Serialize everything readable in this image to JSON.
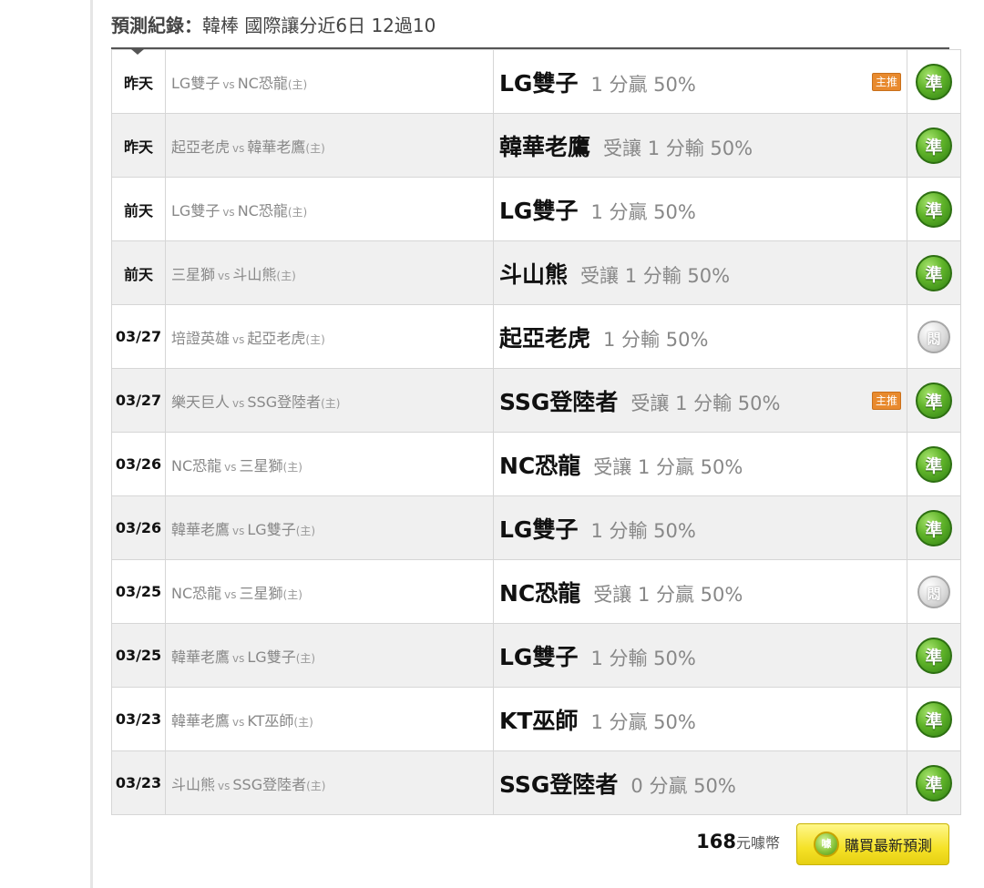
{
  "header": {
    "label": "預測紀錄",
    "colon": "：",
    "value": "韓棒 國際讓分近6日 12過10"
  },
  "rows": [
    {
      "date": "昨天",
      "away": "LG雙子",
      "vs": "vs",
      "home": "NC恐龍",
      "home_tag": "(主)",
      "pick_team": "LG雙子",
      "pick_line": "1 分贏 50%",
      "star": "主推",
      "result": "準",
      "result_type": "win"
    },
    {
      "date": "昨天",
      "away": "起亞老虎",
      "vs": "vs",
      "home": "韓華老鷹",
      "home_tag": "(主)",
      "pick_team": "韓華老鷹",
      "pick_line": "受讓 1 分輸 50%",
      "star": "",
      "result": "準",
      "result_type": "win"
    },
    {
      "date": "前天",
      "away": "LG雙子",
      "vs": "vs",
      "home": "NC恐龍",
      "home_tag": "(主)",
      "pick_team": "LG雙子",
      "pick_line": "1 分贏 50%",
      "star": "",
      "result": "準",
      "result_type": "win"
    },
    {
      "date": "前天",
      "away": "三星獅",
      "vs": "vs",
      "home": "斗山熊",
      "home_tag": "(主)",
      "pick_team": "斗山熊",
      "pick_line": "受讓 1 分輸 50%",
      "star": "",
      "result": "準",
      "result_type": "win"
    },
    {
      "date": "03/27",
      "away": "培證英雄",
      "vs": "vs",
      "home": "起亞老虎",
      "home_tag": "(主)",
      "pick_team": "起亞老虎",
      "pick_line": "1 分輸 50%",
      "star": "",
      "result": "悶",
      "result_type": "push"
    },
    {
      "date": "03/27",
      "away": "樂天巨人",
      "vs": "vs",
      "home": "SSG登陸者",
      "home_tag": "(主)",
      "pick_team": "SSG登陸者",
      "pick_line": "受讓 1 分輸 50%",
      "star": "主推",
      "result": "準",
      "result_type": "win"
    },
    {
      "date": "03/26",
      "away": "NC恐龍",
      "vs": "vs",
      "home": "三星獅",
      "home_tag": "(主)",
      "pick_team": "NC恐龍",
      "pick_line": "受讓 1 分贏 50%",
      "star": "",
      "result": "準",
      "result_type": "win"
    },
    {
      "date": "03/26",
      "away": "韓華老鷹",
      "vs": "vs",
      "home": "LG雙子",
      "home_tag": "(主)",
      "pick_team": "LG雙子",
      "pick_line": "1 分輸 50%",
      "star": "",
      "result": "準",
      "result_type": "win"
    },
    {
      "date": "03/25",
      "away": "NC恐龍",
      "vs": "vs",
      "home": "三星獅",
      "home_tag": "(主)",
      "pick_team": "NC恐龍",
      "pick_line": "受讓 1 分贏 50%",
      "star": "",
      "result": "悶",
      "result_type": "push"
    },
    {
      "date": "03/25",
      "away": "韓華老鷹",
      "vs": "vs",
      "home": "LG雙子",
      "home_tag": "(主)",
      "pick_team": "LG雙子",
      "pick_line": "1 分輸 50%",
      "star": "",
      "result": "準",
      "result_type": "win"
    },
    {
      "date": "03/23",
      "away": "韓華老鷹",
      "vs": "vs",
      "home": "KT巫師",
      "home_tag": "(主)",
      "pick_team": "KT巫師",
      "pick_line": "1 分贏 50%",
      "star": "",
      "result": "準",
      "result_type": "win"
    },
    {
      "date": "03/23",
      "away": "斗山熊",
      "vs": "vs",
      "home": "SSG登陸者",
      "home_tag": "(主)",
      "pick_team": "SSG登陸者",
      "pick_line": "0 分贏 50%",
      "star": "",
      "result": "準",
      "result_type": "win"
    }
  ],
  "footer": {
    "price": "168",
    "price_unit": "元噱幣",
    "buy_label": "購買最新預測",
    "coin_icon_text": "噱"
  },
  "icons": {
    "win_badge": "green-circle-badge-icon",
    "push_badge": "gray-circle-badge-icon",
    "coin": "coin-icon"
  },
  "colors": {
    "win": "#4fa81f",
    "push": "#bdbdbd",
    "star_tag": "#e88a2e",
    "buy_button": "#f5e227"
  }
}
